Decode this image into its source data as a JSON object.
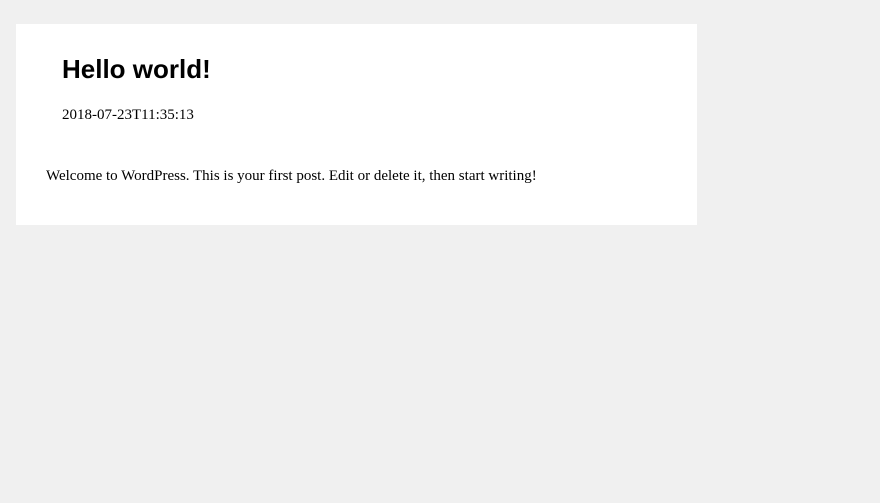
{
  "post": {
    "title": "Hello world!",
    "timestamp": "2018-07-23T11:35:13",
    "body": "Welcome to WordPress. This is your first post. Edit or delete it, then start writing!"
  }
}
